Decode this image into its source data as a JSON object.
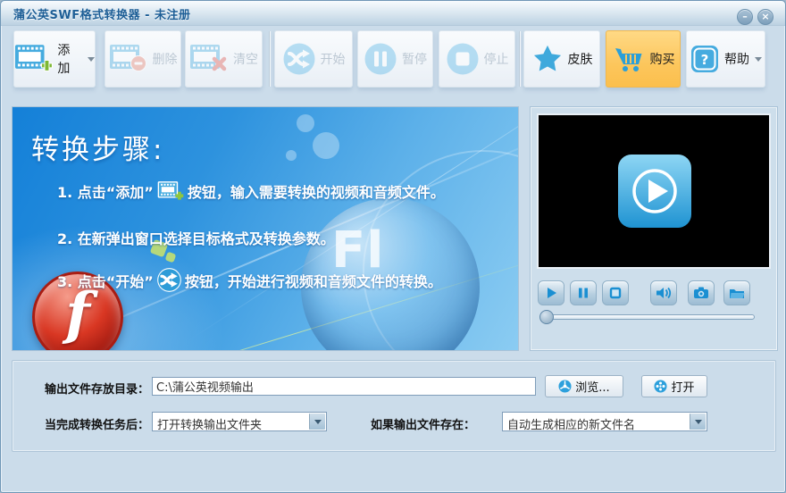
{
  "window": {
    "title": "蒲公英SWF格式转换器 - 未注册",
    "minimize_glyph": "–",
    "close_glyph": "×"
  },
  "toolbar": {
    "add": "添加",
    "delete": "删除",
    "clear": "清空",
    "start": "开始",
    "pause": "暂停",
    "stop": "停止",
    "skin": "皮肤",
    "buy": "购买",
    "help": "帮助"
  },
  "instructions": {
    "title": "转换步骤:",
    "step1_prefix": "1. 点击“添加”",
    "step1_suffix": "按钮，输入需要转换的视频和音频文件。",
    "step2": "2. 在新弹出窗口选择目标格式及转换参数。",
    "step3_prefix": "3. 点击“开始”",
    "step3_suffix": "按钮，开始进行视频和音频文件的转换。",
    "flash_letter": "f",
    "sphere_letters": "Fl"
  },
  "output": {
    "dir_label": "输出文件存放目录：",
    "dir_value": "C:\\蒲公英视频输出",
    "browse_label": "浏览...",
    "open_label": "打开",
    "after_label": "当完成转换任务后：",
    "after_value": "打开转换输出文件夹",
    "exists_label": "如果输出文件存在：",
    "exists_value": "自动生成相应的新文件名"
  },
  "colors": {
    "accent_blue": "#41aadf",
    "buy_orange": "#fcc65c",
    "panel_blue": "#2a8fdc",
    "window_bg": "#cbdcea"
  }
}
